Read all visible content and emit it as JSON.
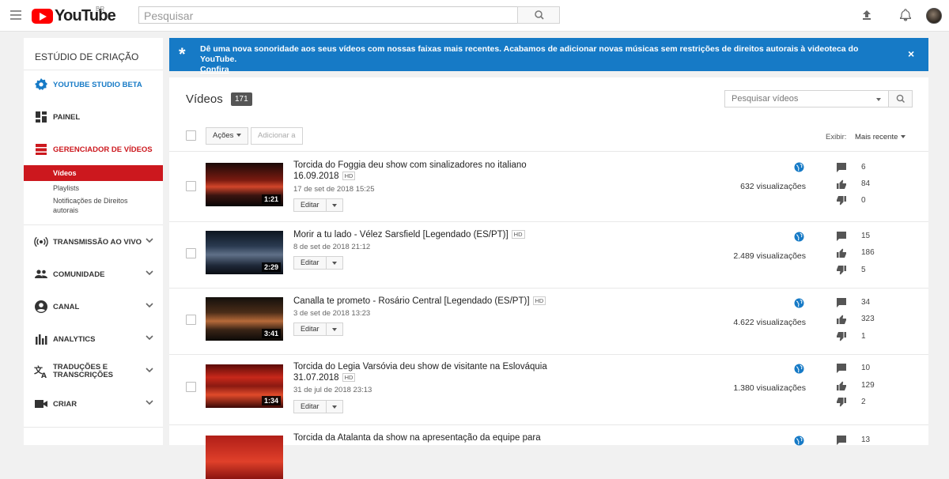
{
  "header": {
    "logo_text": "YouTube",
    "country": "BR",
    "search_placeholder": "Pesquisar"
  },
  "sidebar": {
    "title": "ESTÚDIO DE CRIAÇÃO",
    "studio_beta": "YOUTUBE STUDIO BETA",
    "painel": "PAINEL",
    "gerenciador": "GERENCIADOR DE VÍDEOS",
    "sub_items": [
      "Vídeos",
      "Playlists",
      "Notificações de Direitos autorais"
    ],
    "items": [
      {
        "label": "TRANSMISSÃO AO VIVO",
        "icon": "live-icon"
      },
      {
        "label": "COMUNIDADE",
        "icon": "people-icon"
      },
      {
        "label": "CANAL",
        "icon": "account-icon"
      },
      {
        "label": "ANALYTICS",
        "icon": "bar-chart-icon"
      },
      {
        "label": "TRADUÇÕES E TRANSCRIÇÕES",
        "icon": "translate-icon"
      },
      {
        "label": "CRIAR",
        "icon": "video-camera-icon"
      }
    ]
  },
  "banner": {
    "message": "Dê uma nova sonoridade aos seus vídeos com nossas faixas mais recentes. Acabamos de adicionar novas músicas sem restrições de direitos autorais à videoteca do YouTube.",
    "link": "Confira",
    "close": "×",
    "color": "#167ac6"
  },
  "videos": {
    "title": "Vídeos",
    "count": "171",
    "search_placeholder": "Pesquisar vídeos",
    "actions_label": "Ações",
    "add_to_label": "Adicionar a",
    "show_label": "Exibir:",
    "sort_label": "Mais recente",
    "edit_label": "Editar",
    "hd_label": "HD",
    "rows": [
      {
        "title": "Torcida do Foggia deu show com sinalizadores no italiano 16.09.2018",
        "date": "17 de set de 2018 15:25",
        "duration": "1:21",
        "views": "632 visualizações",
        "comments": "6",
        "likes": "84",
        "dislikes": "0"
      },
      {
        "title": "Morir a tu lado - Vélez Sarsfield [Legendado (ES/PT)]",
        "date": "8 de set de 2018 21:12",
        "duration": "2:29",
        "views": "2.489 visualizações",
        "comments": "15",
        "likes": "186",
        "dislikes": "5"
      },
      {
        "title": "Canalla te prometo - Rosário Central [Legendado (ES/PT)]",
        "date": "3 de set de 2018 13:23",
        "duration": "3:41",
        "views": "4.622 visualizações",
        "comments": "34",
        "likes": "323",
        "dislikes": "1"
      },
      {
        "title": "Torcida do Legia Varsóvia deu show de visitante na Eslováquia 31.07.2018",
        "date": "31 de jul de 2018 23:13",
        "duration": "1:34",
        "views": "1.380 visualizações",
        "comments": "10",
        "likes": "129",
        "dislikes": "2"
      },
      {
        "title": "Torcida da Atalanta da show na apresentação da equipe para",
        "comments": "13"
      }
    ]
  }
}
